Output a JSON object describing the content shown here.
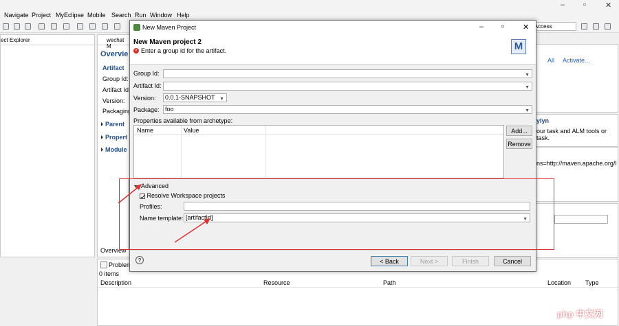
{
  "menu": [
    "Navigate",
    "Project",
    "MyEclipse",
    "Mobile",
    "Search",
    "Run",
    "Window",
    "Help"
  ],
  "toolbar": {
    "quick_access": "k Access"
  },
  "left_panel": {
    "tab_label": "ect Explorer"
  },
  "editor": {
    "tab_label": "wechat M",
    "title": "Overvie",
    "section_artifact": "Artifact",
    "fields": [
      "Group Id:",
      "Artifact Id",
      "Version:",
      "Packaging"
    ],
    "sections": [
      "Parent",
      "Propert",
      "Module"
    ],
    "bottom_tab": "Overview"
  },
  "right_panel": {
    "links": [
      "All",
      "Activate..."
    ],
    "mylyn_title": "ylyn",
    "mylyn_text_1": "our task and ALM tools or",
    "mylyn_text_2": "task.",
    "xmlns_text": "ns=http://maven.apache.org/I"
  },
  "problems": {
    "tab_label": "Problems",
    "count": "0 items",
    "columns": [
      "Description",
      "Resource",
      "Path",
      "Location",
      "Type"
    ]
  },
  "dialog": {
    "title": "New Maven Project",
    "heading": "New Maven project 2",
    "message": "Enter a group id for the artifact.",
    "group_id_label": "Group Id:",
    "group_id_value": "",
    "artifact_id_label": "Artifact Id:",
    "artifact_id_value": "",
    "version_label": "Version:",
    "version_value": "0.0.1-SNAPSHOT",
    "package_label": "Package:",
    "package_value": "foo",
    "properties_label": "Properties available from archetype:",
    "props_columns": [
      "Name",
      "Value"
    ],
    "add_button": "Add...",
    "remove_button": "Remove",
    "advanced_label": "Advanced",
    "resolve_label": "Resolve Workspace projects",
    "profiles_label": "Profiles:",
    "profiles_value": "",
    "name_template_label": "Name template:",
    "name_template_value": "[artifactId]",
    "back_button": "< Back",
    "next_button": "Next >",
    "finish_button": "Finish",
    "cancel_button": "Cancel",
    "logo_letter": "M"
  },
  "watermark": "php 中文网",
  "colors": {
    "annotation_red": "#e03030",
    "link_blue": "#1f5fbf",
    "error_red": "#d93025"
  }
}
